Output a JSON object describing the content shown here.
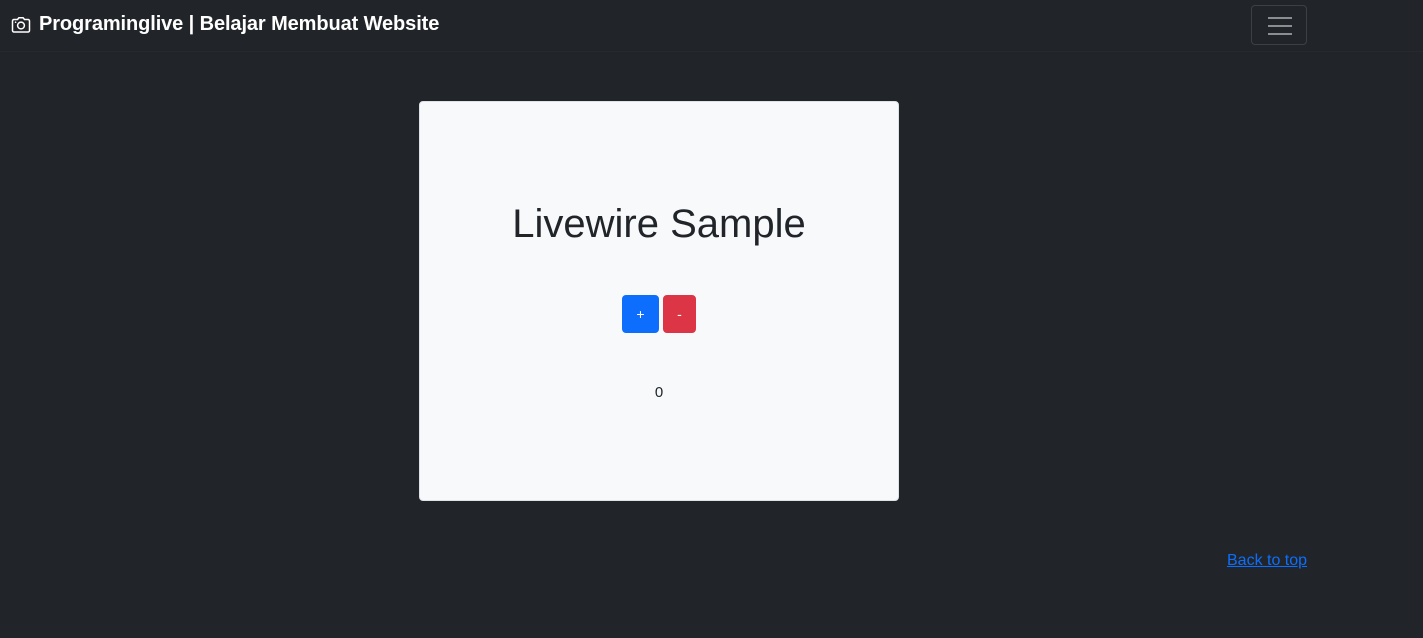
{
  "navbar": {
    "brand_icon": "camera-icon",
    "brand_text": "Programinglive | Belajar Membuat Website",
    "toggler_icon": "hamburger-menu-icon"
  },
  "card": {
    "title": "Livewire Sample",
    "increment_label": "+",
    "decrement_label": "-",
    "count": "0"
  },
  "footer": {
    "back_to_top": "Back to top"
  },
  "colors": {
    "background": "#212529",
    "card": "#f8f9fa",
    "primary": "#0d6efd",
    "danger": "#dc3545"
  }
}
